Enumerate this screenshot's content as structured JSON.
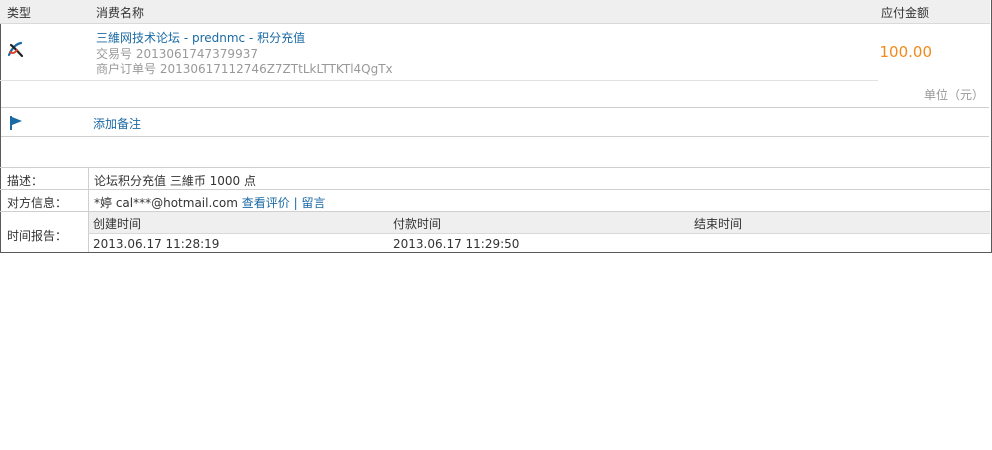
{
  "header": {
    "type_label": "类型",
    "name_label": "消费名称",
    "amount_label": "应付金额"
  },
  "item": {
    "title": "三維网技术论坛 - prednmc - 积分充值",
    "trade_no": "交易号 2013061747379937",
    "order_no": "商户订单号 20130617112746Z7ZTtLkLTTKTl4QgTx",
    "amount": "100.00",
    "icon": "alipay-logo-icon"
  },
  "unit": "单位（元）",
  "note": {
    "link_label": "添加备注",
    "icon": "flag-icon"
  },
  "details": {
    "desc_label": "描述：",
    "desc_value": "论坛积分充值 三維币 1000 点",
    "party_label": "对方信息：",
    "party_value": "*婷 cal***@hotmail.com",
    "view_review": "查看评价",
    "separator": "|",
    "leave_message": "留言",
    "time_label": "时间报告："
  },
  "time_report": {
    "created_label": "创建时间",
    "paid_label": "付款时间",
    "end_label": "结束时间",
    "created_value": "2013.06.17 11:28:19",
    "paid_value": "2013.06.17 11:29:50",
    "end_value": ""
  },
  "colors": {
    "link": "#1a6aa5",
    "amount": "#f08a1a",
    "header_bg": "#efefef"
  }
}
